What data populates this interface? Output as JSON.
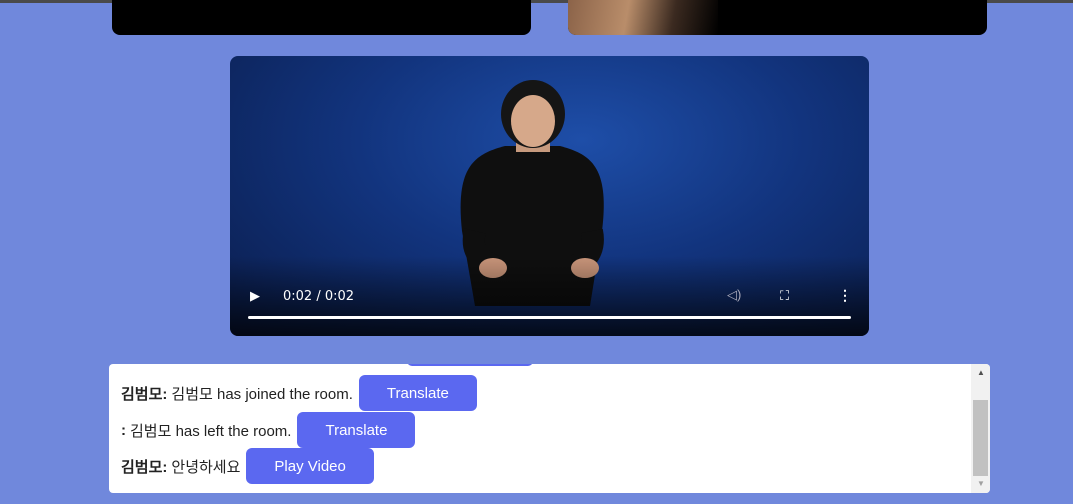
{
  "video": {
    "current_time": "0:02",
    "duration": "0:02",
    "time_display": "0:02 / 0:02",
    "progress": 1.0,
    "play_icon": "play-icon",
    "volume_icon": "volume-icon",
    "fullscreen_icon": "fullscreen-icon",
    "more_icon": "more-vertical-icon"
  },
  "chat": {
    "messages": [
      {
        "sender": "김범모:",
        "text": "김범모 has joined the room.",
        "button": "Translate"
      },
      {
        "sender": ":",
        "text": "김범모 has left the room.",
        "button": "Translate"
      },
      {
        "sender": "김범모:",
        "text": "안녕하세요",
        "button": "Play Video"
      }
    ]
  },
  "colors": {
    "page_background": "#7088dc",
    "button": "#5b68f0",
    "video_background": "#12347e"
  }
}
